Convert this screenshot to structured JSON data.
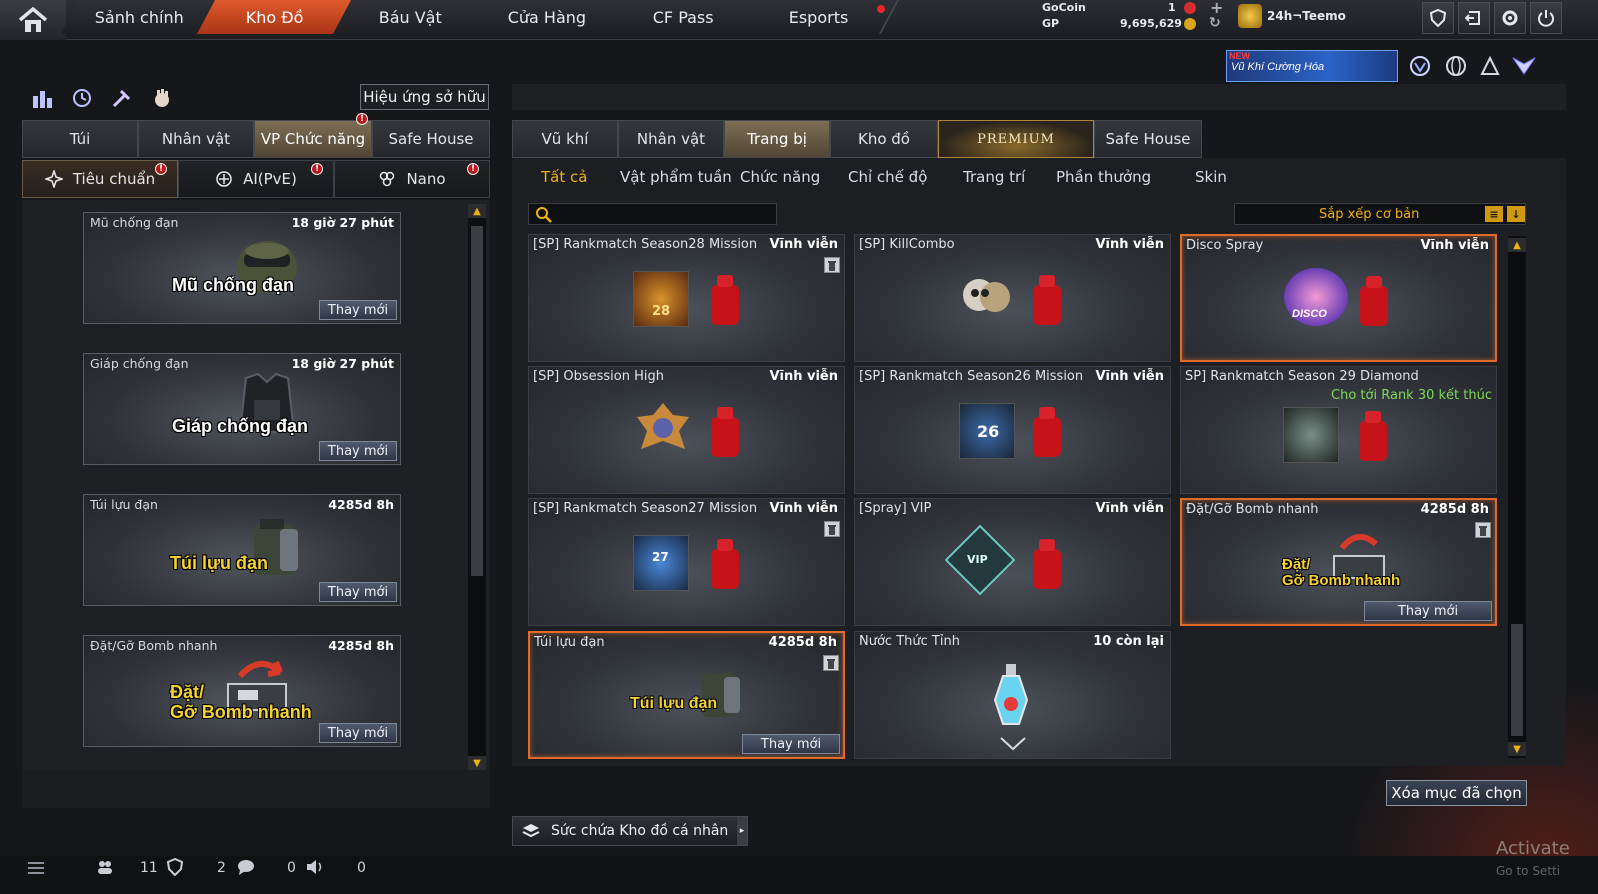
{
  "topbar": {
    "nav": [
      "Sảnh chính",
      "Kho Đồ",
      "Báu Vật",
      "Cửa Hàng",
      "CF Pass",
      "Esports"
    ],
    "active_nav": "Kho Đồ",
    "gocoin_label": "GoCoin",
    "gocoin_value": "1",
    "gp_label": "GP",
    "gp_value": "9,695,629",
    "username": "24h¬Teemo"
  },
  "banner": {
    "new_label": "NEW",
    "text": "Vũ Khí Cường Hóa"
  },
  "left": {
    "effect_button": "Hiệu ứng sở hữu",
    "tabs": [
      "Túi",
      "Nhân vật",
      "VP Chức năng",
      "Safe House"
    ],
    "active_tab": "VP Chức năng",
    "subtabs": [
      "Tiêu chuẩn",
      "AI(PvE)",
      "Nano"
    ],
    "items": [
      {
        "title": "Mũ chống đạn",
        "time": "18 giờ 27 phút",
        "art": "Mũ chống đạn",
        "renew": "Thay mới"
      },
      {
        "title": "Giáp chống đạn",
        "time": "18 giờ 27 phút",
        "art": "Giáp chống đạn",
        "renew": "Thay mới"
      },
      {
        "title": "Túi lựu đạn",
        "time": "4285d 8h",
        "art": "Túi lựu đạn",
        "renew": "Thay mới"
      },
      {
        "title": "Đặt/Gỡ Bomb nhanh",
        "time": "4285d 8h",
        "art1": "Đặt/",
        "art2": "Gỡ Bomb nhanh",
        "renew": "Thay mới"
      }
    ]
  },
  "right": {
    "tabs": [
      "Vũ khí",
      "Nhân vật",
      "Trang bị",
      "Kho đồ",
      "PREMIUM",
      "Safe House"
    ],
    "active_tab": "Trang bị",
    "filters": [
      "Tất cả",
      "Vật phẩm tuần",
      "Chức năng",
      "Chỉ chế độ",
      "Trang trí",
      "Phần thưởng",
      "Skin"
    ],
    "active_filter": "Tất cả",
    "search_placeholder": "",
    "sort_label": "Sắp xếp cơ bản",
    "items": [
      {
        "title": "[SP] Rankmatch Season28 Mission",
        "dur": "Vĩnh viễn",
        "badge": "28"
      },
      {
        "title": "[SP] KillCombo",
        "dur": "Vĩnh viễn"
      },
      {
        "title": "Disco Spray",
        "dur": "Vĩnh viễn",
        "badge": "DISCO"
      },
      {
        "title": "[SP] Obsession High",
        "dur": "Vĩnh viễn"
      },
      {
        "title": "[SP] Rankmatch Season26 Mission",
        "dur": "Vĩnh viễn",
        "badge": "26"
      },
      {
        "title": "SP] Rankmatch Season 29 Diamond",
        "dur": "",
        "note": "Cho tới Rank 30 kết thúc"
      },
      {
        "title": "[SP] Rankmatch Season27 Mission",
        "dur": "Vĩnh viễn",
        "badge": "27"
      },
      {
        "title": "[Spray] VIP",
        "dur": "Vĩnh viễn",
        "badge": "VIP"
      },
      {
        "title": "Đặt/Gỡ Bomb nhanh",
        "dur": "4285d 8h",
        "art1": "Đặt/",
        "art2": "Gỡ Bomb nhanh",
        "renew": "Thay mới"
      },
      {
        "title": "Túi lựu đạn",
        "dur": "4285d 8h",
        "art": "Túi lựu đạn",
        "renew": "Thay mới"
      },
      {
        "title": "Nước Thức Tỉnh",
        "dur": "10 còn lại"
      }
    ],
    "delete_button": "Xóa mục đã chọn",
    "capacity_label": "Sức chứa Kho đồ cá nhân"
  },
  "statusbar": {
    "s1": "11",
    "s2": "2",
    "s3": "0",
    "s4": "0"
  },
  "watermark": {
    "line1": "Activate",
    "line2": "Go to Setti"
  },
  "colors": {
    "accent": "#e05a2c",
    "highlight": "#f0b010",
    "note_green": "#7ed957"
  }
}
